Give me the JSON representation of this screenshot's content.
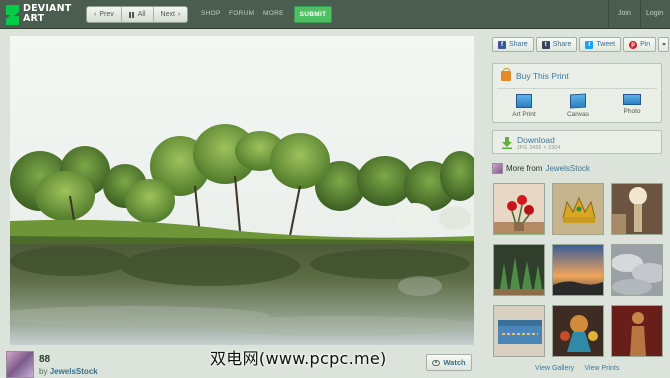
{
  "brand": {
    "name_line1": "DEVIANT",
    "name_line2": "ART",
    "accent": "#05cc47"
  },
  "nav": {
    "prev_label": "Prev",
    "all_label": "All",
    "next_label": "Next",
    "shop": "SHOP",
    "forum": "FORUM",
    "more": "MORE",
    "submit": "SUBMIT",
    "join": "Join",
    "login": "Login"
  },
  "artwork": {
    "favourites": "88",
    "by_prefix": "by",
    "author": "JewelsStock",
    "watch_label": "Watch"
  },
  "watermark": "双电网(www.pcpc.me)",
  "share": {
    "items": [
      {
        "label": "Share",
        "icon": "facebook-icon",
        "glyph": "f",
        "color": "#3b5998"
      },
      {
        "label": "Share",
        "icon": "tumblr-icon",
        "glyph": "t",
        "color": "#35465c"
      },
      {
        "label": "Tweet",
        "icon": "twitter-icon",
        "glyph": "t",
        "color": "#1da1f2"
      },
      {
        "label": "Pin",
        "icon": "pinterest-icon",
        "glyph": "p",
        "color": "#cb2027"
      }
    ]
  },
  "buy": {
    "title": "Buy This Print",
    "options": [
      "Art Print",
      "Canvas",
      "Photo"
    ]
  },
  "download": {
    "title": "Download",
    "meta": "JPG 3456 × 2304"
  },
  "more_from": {
    "prefix": "More from",
    "author": "JewelsStock",
    "view_gallery": "View Gallery",
    "view_prints": "View Prints"
  }
}
